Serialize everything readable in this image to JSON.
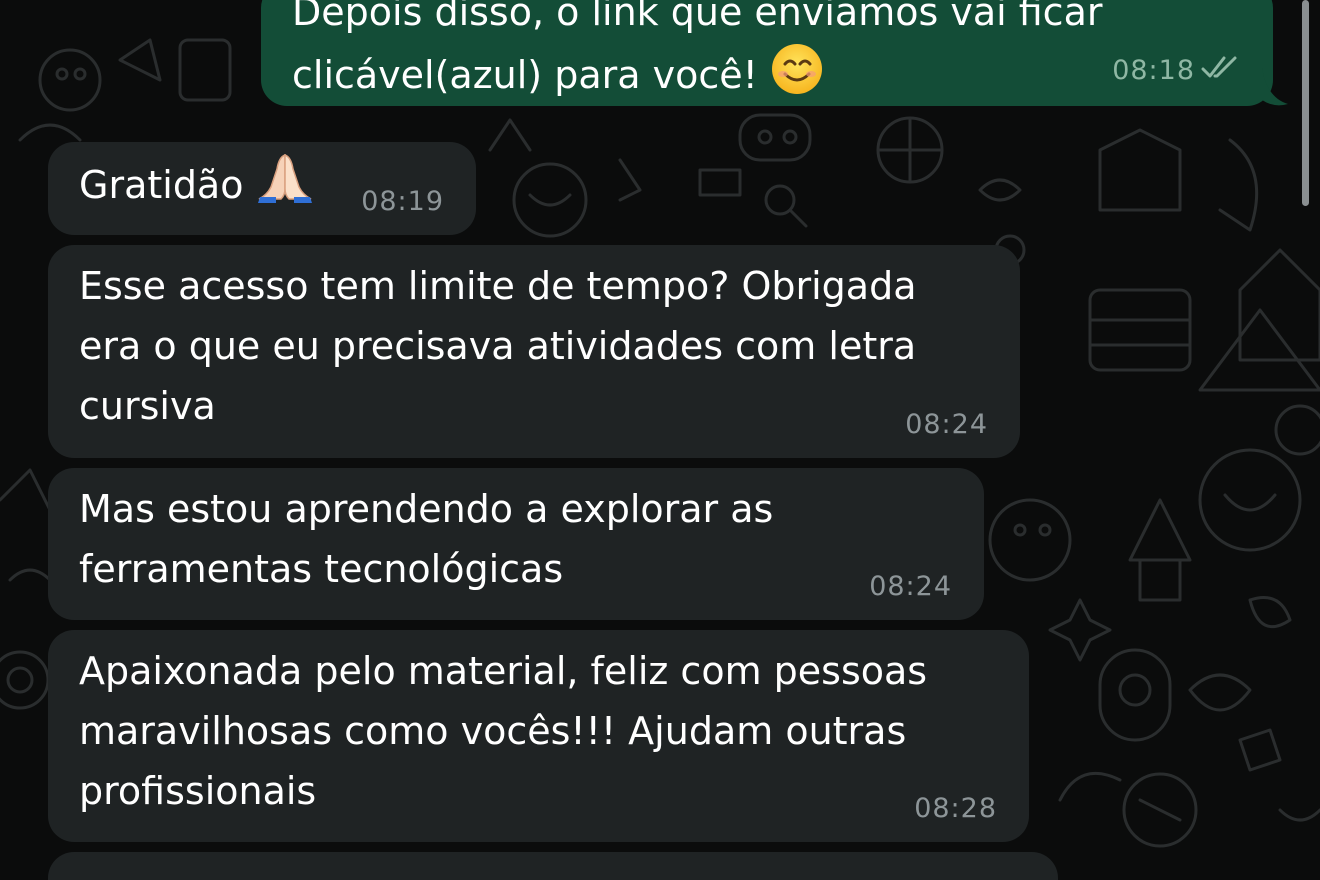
{
  "messages": [
    {
      "direction": "outgoing",
      "text_line1": "Depois disso, o link que enviamos vai ficar",
      "text_line2": "clicável(azul) para você!",
      "emoji": "smiling-face-emoji",
      "time": "08:18",
      "status_icon": "double-check-icon"
    },
    {
      "direction": "incoming",
      "text": "Gratidão",
      "emoji": "folded-hands-emoji",
      "time": "08:19"
    },
    {
      "direction": "incoming",
      "text": "Esse acesso tem limite de tempo? Obrigada\nera o que eu precisava atividades com letra\ncursiva",
      "time": "08:24"
    },
    {
      "direction": "incoming",
      "text": "Mas estou aprendendo a explorar as\nferramentas tecnológicas",
      "time": "08:24"
    },
    {
      "direction": "incoming",
      "text": "Apaixonada pelo material, feliz com pessoas\nmaravilhosas como vocês!!! Ajudam outras\nprofissionais",
      "time": "08:28"
    }
  ],
  "colors": {
    "background": "#0b0c0c",
    "incoming_bubble": "#1f2324",
    "outgoing_bubble": "#134d37",
    "timestamp": "#8d9598"
  }
}
